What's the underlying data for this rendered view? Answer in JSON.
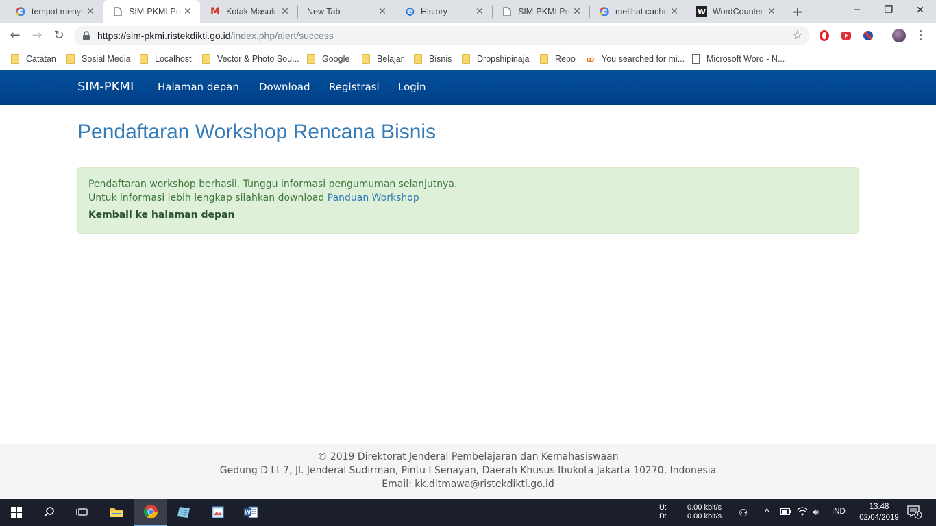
{
  "browser": {
    "tabs": [
      {
        "title": "tempat menyir",
        "icon": "google-icon",
        "active": false
      },
      {
        "title": "SIM-PKMI Prog",
        "icon": "page-icon",
        "active": true
      },
      {
        "title": "Kotak Masuk (",
        "icon": "gmail-icon",
        "active": false
      },
      {
        "title": "New Tab",
        "icon": "",
        "active": false
      },
      {
        "title": "History",
        "icon": "history-icon",
        "active": false
      },
      {
        "title": "SIM-PKMI Prog",
        "icon": "page-icon",
        "active": false
      },
      {
        "title": "melihat cache",
        "icon": "google-icon",
        "active": false
      },
      {
        "title": "WordCounter",
        "icon": "wordcounter-icon",
        "active": false
      }
    ],
    "url": {
      "scheme_host": "https://sim-pkmi.ristekdikti.go.id",
      "path": "/index.php/alert/success"
    },
    "bookmarks": [
      {
        "label": "Catatan",
        "type": "folder"
      },
      {
        "label": "Sosial Media",
        "type": "folder"
      },
      {
        "label": "Localhost",
        "type": "folder"
      },
      {
        "label": "Vector & Photo Sou...",
        "type": "folder"
      },
      {
        "label": "Google",
        "type": "folder"
      },
      {
        "label": "Belajar",
        "type": "folder"
      },
      {
        "label": "Bisnis",
        "type": "folder"
      },
      {
        "label": "Dropshipinaja",
        "type": "folder"
      },
      {
        "label": "Repo",
        "type": "folder"
      },
      {
        "label": "You searched for mi...",
        "type": "site"
      },
      {
        "label": "Microsoft Word - N...",
        "type": "page"
      }
    ]
  },
  "site": {
    "brand": "SIM-PKMI",
    "nav": [
      "Halaman depan",
      "Download",
      "Registrasi",
      "Login"
    ],
    "page_title": "Pendaftaran Workshop Rencana Bisnis",
    "alert": {
      "line1": "Pendaftaran workshop berhasil. Tunggu informasi pengumuman selanjutnya.",
      "line2_prefix": "Untuk informasi lebih lengkap silahkan download ",
      "line2_link": "Panduan Workshop",
      "back_link": "Kembali ke halaman depan"
    },
    "footer": {
      "line1": "© 2019 Direktorat Jenderal Pembelajaran dan Kemahasiswaan",
      "line2": "Gedung D Lt 7, Jl. Jenderal Sudirman, Pintu I Senayan, Daerah Khusus Ibukota Jakarta 10270, Indonesia",
      "line3": "Email: kk.ditmawa@ristekdikti.go.id"
    }
  },
  "taskbar": {
    "net_up_label": "U:",
    "net_down_label": "D:",
    "net_up": "0.00 kbit/s",
    "net_down": "0.00 kbit/s",
    "lang": "IND",
    "time": "13.48",
    "date": "02/04/2019",
    "notification_count": "1"
  },
  "colors": {
    "navbar": "#0a4f98",
    "link": "#337ab7",
    "alert_bg": "#dff0d8",
    "alert_text": "#3c763d"
  }
}
